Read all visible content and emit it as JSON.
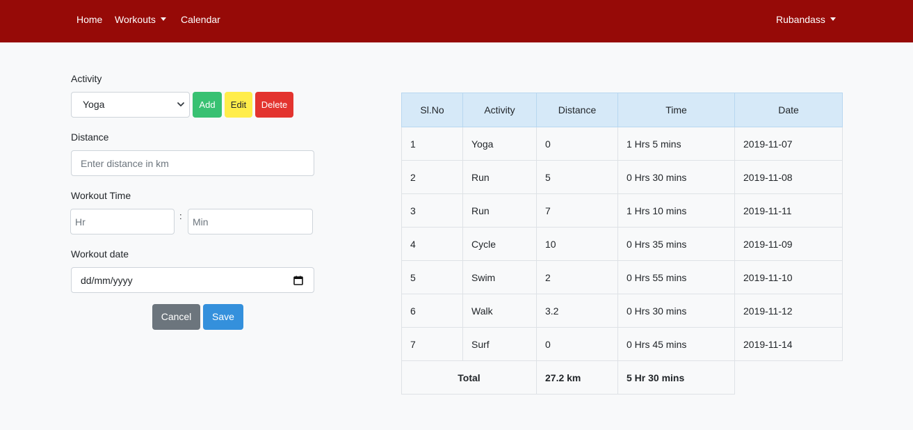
{
  "navbar": {
    "home": "Home",
    "workouts": "Workouts",
    "calendar": "Calendar",
    "user": "Rubandass"
  },
  "form": {
    "activity_label": "Activity",
    "activity_selected": "Yoga",
    "add_label": "Add",
    "edit_label": "Edit",
    "delete_label": "Delete",
    "distance_label": "Distance",
    "distance_placeholder": "Enter distance in km",
    "time_label": "Workout Time",
    "hr_placeholder": "Hr",
    "time_separator": ":",
    "min_placeholder": "Min",
    "date_label": "Workout date",
    "date_placeholder": "dd/mm/yyyy",
    "cancel_label": "Cancel",
    "save_label": "Save"
  },
  "table": {
    "headers": [
      "Sl.No",
      "Activity",
      "Distance",
      "Time",
      "Date"
    ],
    "rows": [
      [
        "1",
        "Yoga",
        "0",
        "1 Hrs 5 mins",
        "2019-11-07"
      ],
      [
        "2",
        "Run",
        "5",
        "0 Hrs 30 mins",
        "2019-11-08"
      ],
      [
        "3",
        "Run",
        "7",
        "1 Hrs 10 mins",
        "2019-11-11"
      ],
      [
        "4",
        "Cycle",
        "10",
        "0 Hrs 35 mins",
        "2019-11-09"
      ],
      [
        "5",
        "Swim",
        "2",
        "0 Hrs 55 mins",
        "2019-11-10"
      ],
      [
        "6",
        "Walk",
        "3.2",
        "0 Hrs 30 mins",
        "2019-11-12"
      ],
      [
        "7",
        "Surf",
        "0",
        "0 Hrs 45 mins",
        "2019-11-14"
      ]
    ],
    "total": {
      "label": "Total",
      "distance": "27.2 km",
      "time": "5 Hr 30 mins"
    }
  },
  "colors": {
    "navbar": "#960a07",
    "add": "#38c172",
    "edit": "#ffed4a",
    "delete": "#e3342f",
    "cancel": "#6c757d",
    "save": "#3490dc",
    "table_header": "#d6e9f8"
  }
}
